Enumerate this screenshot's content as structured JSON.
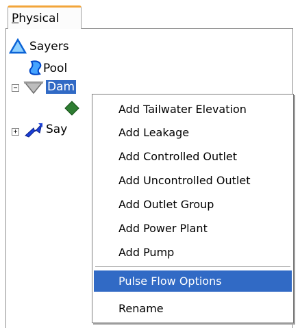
{
  "tab": {
    "label_first": "P",
    "label_rest": "hysical"
  },
  "tree": {
    "root": {
      "label": "Sayers"
    },
    "pool": {
      "label": "Pool"
    },
    "dam": {
      "label": "Dam",
      "expander": "−"
    },
    "sayers_reach": {
      "label": "Say",
      "expander": "+"
    }
  },
  "context_menu": {
    "items": [
      {
        "label": "Add Tailwater Elevation"
      },
      {
        "label": "Add Leakage"
      },
      {
        "label": "Add Controlled Outlet"
      },
      {
        "label": "Add Uncontrolled Outlet"
      },
      {
        "label": "Add Outlet Group"
      },
      {
        "label": "Add Power Plant"
      },
      {
        "label": "Add Pump"
      },
      {
        "label": "Pulse Flow Options",
        "highlighted": true
      },
      {
        "label": "Rename"
      }
    ]
  },
  "colors": {
    "selection": "#316ac5",
    "tab_accent": "#f2a53a",
    "reservoir_triangle": "#3aa0f0",
    "pool_blue": "#1e6ff0",
    "leaf_green": "#2e7d32"
  },
  "icons": {
    "root": "triangle-icon",
    "pool": "pool-icon",
    "dam": "dam-icon",
    "outlet": "diamond-icon",
    "reach": "reach-icon"
  }
}
